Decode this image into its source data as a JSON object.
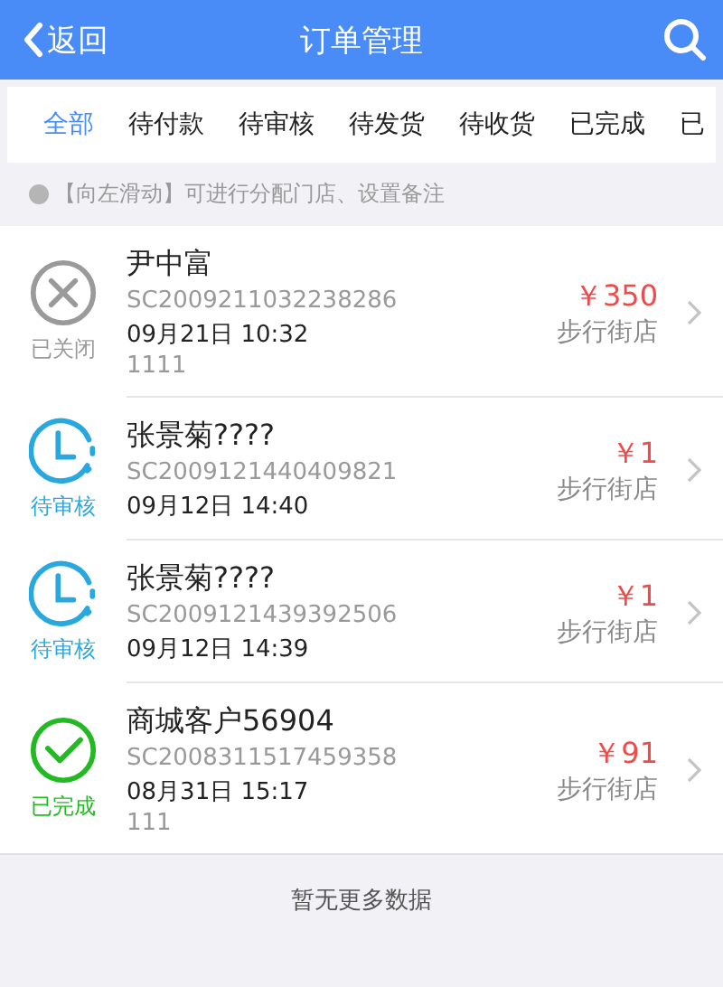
{
  "header": {
    "back": "返回",
    "title": "订单管理"
  },
  "tabs": [
    {
      "label": "全部",
      "selected": true
    },
    {
      "label": "待付款",
      "selected": false
    },
    {
      "label": "待审核",
      "selected": false
    },
    {
      "label": "待发货",
      "selected": false
    },
    {
      "label": "待收货",
      "selected": false
    },
    {
      "label": "已完成",
      "selected": false
    },
    {
      "label": "已",
      "selected": false
    }
  ],
  "hint": "【向左滑动】可进行分配门店、设置备注",
  "orders": [
    {
      "kind": "closed",
      "status_label": "已关闭",
      "customer": "尹中富",
      "order_no": "SC2009211032238286",
      "time": "09月21日 10:32",
      "note": "1111",
      "amount": "￥350",
      "store": "步行街店"
    },
    {
      "kind": "review",
      "status_label": "待审核",
      "customer": "张景菊????",
      "order_no": "SC2009121440409821",
      "time": "09月12日 14:40",
      "amount": "￥1",
      "store": "步行街店"
    },
    {
      "kind": "review",
      "status_label": "待审核",
      "customer": "张景菊????",
      "order_no": "SC2009121439392506",
      "time": "09月12日 14:39",
      "amount": "￥1",
      "store": "步行街店"
    },
    {
      "kind": "done",
      "status_label": "已完成",
      "customer": "商城客户56904",
      "order_no": "SC2008311517459358",
      "time": "08月31日 15:17",
      "note": "111",
      "amount": "￥91",
      "store": "步行街店"
    }
  ],
  "footer": "暂无更多数据"
}
